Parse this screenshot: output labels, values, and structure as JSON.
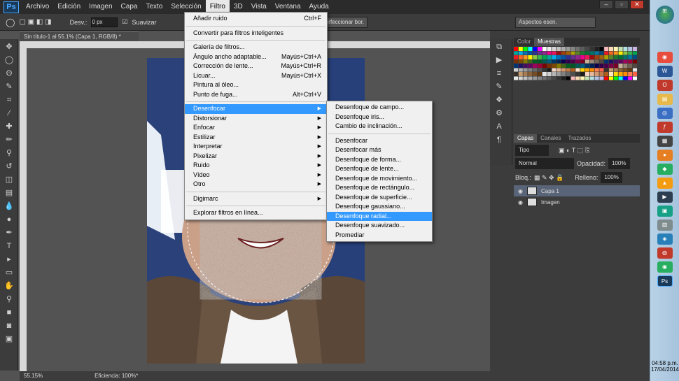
{
  "menubar": {
    "items": [
      "Archivo",
      "Edición",
      "Imagen",
      "Capa",
      "Texto",
      "Selección",
      "Filtro",
      "3D",
      "Vista",
      "Ventana",
      "Ayuda"
    ],
    "active": "Filtro"
  },
  "options": {
    "feather_label": "Desv.:",
    "feather_value": "0 px",
    "antialias": "Suavizar",
    "refine": "Perfeccionar bor.",
    "workspace": "Aspectos esen."
  },
  "document": {
    "tab": "Sin título-1 al 55.1% (Capa 1, RGB/8) *",
    "zoom": "55.15%",
    "status": "Eficiencia: 100%*"
  },
  "filter_menu": [
    {
      "label": "Añadir ruido",
      "shortcut": "Ctrl+F"
    },
    {
      "sep": true
    },
    {
      "label": "Convertir para filtros inteligentes",
      "shortcut": ""
    },
    {
      "sep": true
    },
    {
      "label": "Galería de filtros...",
      "shortcut": ""
    },
    {
      "label": "Ángulo ancho adaptable...",
      "shortcut": "Mayús+Ctrl+A"
    },
    {
      "label": "Corrección de lente...",
      "shortcut": "Mayús+Ctrl+R"
    },
    {
      "label": "Licuar...",
      "shortcut": "Mayús+Ctrl+X"
    },
    {
      "label": "Pintura al óleo...",
      "shortcut": ""
    },
    {
      "label": "Punto de fuga...",
      "shortcut": "Alt+Ctrl+V"
    },
    {
      "sep": true
    },
    {
      "label": "Desenfocar",
      "shortcut": "",
      "sub": true,
      "hl": true
    },
    {
      "label": "Distorsionar",
      "shortcut": "",
      "sub": true
    },
    {
      "label": "Enfocar",
      "shortcut": "",
      "sub": true
    },
    {
      "label": "Estilizar",
      "shortcut": "",
      "sub": true
    },
    {
      "label": "Interpretar",
      "shortcut": "",
      "sub": true
    },
    {
      "label": "Pixelizar",
      "shortcut": "",
      "sub": true
    },
    {
      "label": "Ruido",
      "shortcut": "",
      "sub": true
    },
    {
      "label": "Vídeo",
      "shortcut": "",
      "sub": true
    },
    {
      "label": "Otro",
      "shortcut": "",
      "sub": true
    },
    {
      "sep": true
    },
    {
      "label": "Digimarc",
      "shortcut": "",
      "sub": true
    },
    {
      "sep": true
    },
    {
      "label": "Explorar filtros en línea...",
      "shortcut": ""
    }
  ],
  "blur_submenu": [
    {
      "label": "Desenfoque de campo..."
    },
    {
      "label": "Desenfoque iris..."
    },
    {
      "label": "Cambio de inclinación..."
    },
    {
      "sep": true
    },
    {
      "label": "Desenfocar"
    },
    {
      "label": "Desenfocar más"
    },
    {
      "label": "Desenfoque de forma..."
    },
    {
      "label": "Desenfoque de lente..."
    },
    {
      "label": "Desenfoque de movimiento..."
    },
    {
      "label": "Desenfoque de rectángulo..."
    },
    {
      "label": "Desenfoque de superficie..."
    },
    {
      "label": "Desenfoque gaussiano..."
    },
    {
      "label": "Desenfoque radial...",
      "hl": true
    },
    {
      "label": "Desenfoque suavizado..."
    },
    {
      "label": "Promediar"
    }
  ],
  "panels": {
    "color_tab": "Color",
    "swatches_tab": "Muestras",
    "layers_tab": "Capas",
    "channels_tab": "Canales",
    "paths_tab": "Trazados",
    "kind": "Tipo",
    "blend": "Normal",
    "opacity_label": "Opacidad:",
    "opacity": "100%",
    "lock_label": "Bloq.:",
    "fill_label": "Relleno:",
    "fill": "100%"
  },
  "layers": [
    {
      "name": "Capa 1"
    },
    {
      "name": "Imagen"
    }
  ],
  "taskbar": {
    "time": "04:58 p.m.",
    "date": "17/04/2014"
  }
}
